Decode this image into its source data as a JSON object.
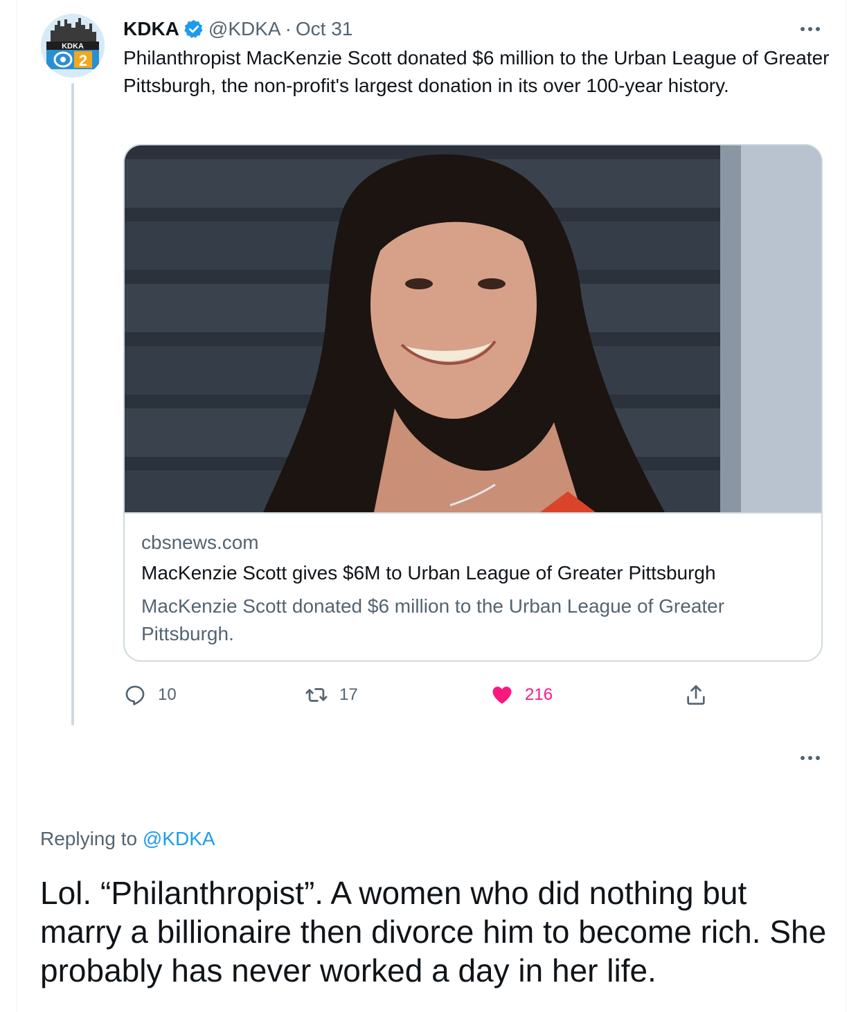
{
  "tweet": {
    "display_name": "KDKA",
    "handle": "@KDKA",
    "separator": "·",
    "date": "Oct 31",
    "text": "Philanthropist MacKenzie Scott donated $6 million to the Urban League of Greater Pittsburgh, the non-profit's largest donation in its over 100-year history.",
    "avatar": {
      "logo_text": "KDKA",
      "channel": "2"
    },
    "card": {
      "domain": "cbsnews.com",
      "title": "MacKenzie Scott gives $6M to Urban League of Greater Pittsburgh",
      "description": "MacKenzie Scott donated $6 million to the Urban League of Greater Pittsburgh."
    },
    "actions": {
      "replies": "10",
      "retweets": "17",
      "likes": "216"
    }
  },
  "reply": {
    "replying_prefix": "Replying to",
    "replying_to": "@KDKA",
    "text": "Lol. “Philanthropist”. A women who did nothing but marry a billionaire then divorce him to become rich. She probably has never worked a day in her life."
  },
  "colors": {
    "accent": "#1d9bf0",
    "like": "#f91880",
    "secondary_text": "#536471",
    "border": "#cfd9de"
  },
  "icons": [
    "verified-badge-icon",
    "more-icon",
    "reply-icon",
    "retweet-icon",
    "like-icon",
    "share-icon"
  ]
}
